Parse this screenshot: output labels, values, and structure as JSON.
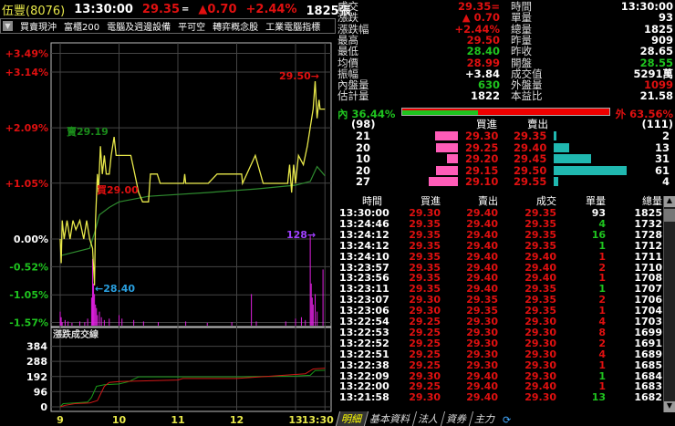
{
  "header": {
    "stock_name": "伍豐(8076)",
    "time": "13:30:00",
    "price": "29.35",
    "flat_mark": "=",
    "change": "▲0.70",
    "change_pct": "+2.44%",
    "volume": "1825張"
  },
  "tags": [
    "買賣現沖",
    "富櫃200",
    "電腦及週邊設備",
    "平可空",
    "轉弈概念股",
    "工業電腦指標"
  ],
  "quote": {
    "left": [
      [
        "成交",
        "29.35=",
        "red"
      ],
      [
        "漲跌",
        "▲ 0.70",
        "red"
      ],
      [
        "漲跌幅",
        "+2.44%",
        "red"
      ],
      [
        "最高",
        "29.50",
        "red"
      ],
      [
        "最低",
        "28.40",
        "green"
      ],
      [
        "均價",
        "28.99",
        "red"
      ],
      [
        "振幅",
        "+3.84",
        "white"
      ],
      [
        "內盤量",
        "630",
        "green"
      ],
      [
        "估計量",
        "1822",
        "white"
      ]
    ],
    "right": [
      [
        "時間",
        "13:30:00",
        "white"
      ],
      [
        "單量",
        "93",
        "white"
      ],
      [
        "總量",
        "1825",
        "white"
      ],
      [
        "昨量",
        "909",
        "white"
      ],
      [
        "昨收",
        "28.65",
        "white"
      ],
      [
        "開盤",
        "28.55",
        "green"
      ],
      [
        "成交值",
        "5291萬",
        "white"
      ],
      [
        "外盤量",
        "1099",
        "red"
      ],
      [
        "本益比",
        "21.58",
        "white"
      ]
    ]
  },
  "ratio": {
    "inner_label": "內 36.44%",
    "outer_label": "外 63.56%",
    "inner_pct": 36.44
  },
  "orderbook": {
    "bid_total": "(98)",
    "ask_total": "(111)",
    "bid_header": "買進",
    "ask_header": "賣出",
    "rows": [
      [
        "21",
        "29.30",
        "29.35",
        "2"
      ],
      [
        "20",
        "29.25",
        "29.40",
        "13"
      ],
      [
        "10",
        "29.20",
        "29.45",
        "31"
      ],
      [
        "20",
        "29.15",
        "29.50",
        "61"
      ],
      [
        "27",
        "29.10",
        "29.55",
        "4"
      ]
    ]
  },
  "ticks": {
    "headers": [
      "時間",
      "買進",
      "賣出",
      "成交",
      "單量",
      "總量"
    ],
    "rows": [
      [
        "13:30:00",
        "29.30",
        "29.40",
        "29.35",
        "93",
        "1825",
        "white"
      ],
      [
        "13:24:46",
        "29.35",
        "29.40",
        "29.35",
        "4",
        "1732",
        "green"
      ],
      [
        "13:24:12",
        "29.35",
        "29.40",
        "29.35",
        "16",
        "1728",
        "green"
      ],
      [
        "13:24:12",
        "29.35",
        "29.40",
        "29.35",
        "1",
        "1712",
        "green"
      ],
      [
        "13:24:10",
        "29.35",
        "29.40",
        "29.40",
        "1",
        "1711",
        "red"
      ],
      [
        "13:23:57",
        "29.35",
        "29.40",
        "29.40",
        "2",
        "1710",
        "red"
      ],
      [
        "13:23:56",
        "29.35",
        "29.40",
        "29.40",
        "1",
        "1708",
        "red"
      ],
      [
        "13:23:11",
        "29.35",
        "29.40",
        "29.35",
        "1",
        "1707",
        "green"
      ],
      [
        "13:23:07",
        "29.30",
        "29.35",
        "29.35",
        "2",
        "1706",
        "red"
      ],
      [
        "13:23:06",
        "29.30",
        "29.35",
        "29.35",
        "1",
        "1704",
        "red"
      ],
      [
        "13:22:54",
        "29.25",
        "29.30",
        "29.30",
        "4",
        "1703",
        "red"
      ],
      [
        "13:22:53",
        "29.25",
        "29.30",
        "29.30",
        "8",
        "1699",
        "red"
      ],
      [
        "13:22:52",
        "29.25",
        "29.30",
        "29.30",
        "2",
        "1691",
        "red"
      ],
      [
        "13:22:51",
        "29.25",
        "29.30",
        "29.30",
        "4",
        "1689",
        "red"
      ],
      [
        "13:22:38",
        "29.25",
        "29.30",
        "29.30",
        "1",
        "1685",
        "red"
      ],
      [
        "13:22:09",
        "29.30",
        "29.40",
        "29.30",
        "1",
        "1684",
        "green"
      ],
      [
        "13:22:00",
        "29.25",
        "29.40",
        "29.40",
        "1",
        "1683",
        "red"
      ],
      [
        "13:21:58",
        "29.30",
        "29.40",
        "29.30",
        "13",
        "1682",
        "green"
      ]
    ]
  },
  "tabs": [
    "明細",
    "基本資料",
    "法人",
    "資券",
    "主力"
  ],
  "chart_data": {
    "type": "line",
    "title": "intraday",
    "prev_close": 28.65,
    "y_ticks": [
      "+3.49%",
      "+3.14%",
      "+2.09%",
      "+1.05%",
      "0.00%",
      "-0.52%",
      "-1.05%",
      "-1.57%"
    ],
    "y_tick_values": [
      3.49,
      3.14,
      2.09,
      1.05,
      0,
      -0.52,
      -1.05,
      -1.57
    ],
    "x_ticks": [
      "9",
      "10",
      "11",
      "12",
      "13",
      "13:30"
    ],
    "x_tick_minutes": [
      0,
      60,
      120,
      180,
      240,
      270
    ],
    "annotations": {
      "high": "29.50→",
      "low": "←28.40",
      "sell": "賣29.19",
      "buy": "買29.00",
      "max_vol": "128→"
    },
    "price": [
      [
        0,
        28.65
      ],
      [
        1,
        28.52
      ],
      [
        2,
        28.75
      ],
      [
        4,
        28.65
      ],
      [
        7,
        28.75
      ],
      [
        10,
        28.65
      ],
      [
        13,
        28.75
      ],
      [
        16,
        28.7
      ],
      [
        20,
        28.75
      ],
      [
        24,
        28.65
      ],
      [
        27,
        28.75
      ],
      [
        30,
        28.65
      ],
      [
        33,
        28.6
      ],
      [
        35,
        28.4
      ],
      [
        36,
        28.75
      ],
      [
        38,
        29.0
      ],
      [
        39,
        28.9
      ],
      [
        41,
        29.15
      ],
      [
        43,
        29.0
      ],
      [
        45,
        29.1
      ],
      [
        47,
        29.0
      ],
      [
        50,
        29.0
      ],
      [
        52,
        29.1
      ],
      [
        55,
        29.2
      ],
      [
        57,
        29.1
      ],
      [
        72,
        29.1
      ],
      [
        74,
        29.05
      ],
      [
        80,
        28.9
      ],
      [
        84,
        28.85
      ],
      [
        90,
        28.85
      ],
      [
        92,
        29.0
      ],
      [
        99,
        29.0
      ],
      [
        102,
        28.95
      ],
      [
        126,
        28.95
      ],
      [
        127,
        29.0
      ],
      [
        128,
        28.95
      ],
      [
        151,
        28.95
      ],
      [
        160,
        29.0
      ],
      [
        185,
        29.0
      ],
      [
        186,
        28.95
      ],
      [
        199,
        29.1
      ],
      [
        207,
        28.95
      ],
      [
        232,
        28.95
      ],
      [
        234,
        29.05
      ],
      [
        236,
        28.9
      ],
      [
        238,
        29.05
      ],
      [
        240,
        28.95
      ],
      [
        243,
        29.1
      ],
      [
        248,
        29.05
      ],
      [
        252,
        29.15
      ],
      [
        255,
        29.25
      ],
      [
        258,
        29.35
      ],
      [
        260,
        29.5
      ],
      [
        262,
        29.3
      ],
      [
        264,
        29.4
      ],
      [
        265,
        29.35
      ],
      [
        270,
        29.35
      ]
    ],
    "avg": [
      [
        0,
        28.56
      ],
      [
        30,
        28.6
      ],
      [
        36,
        28.7
      ],
      [
        40,
        28.78
      ],
      [
        50,
        28.82
      ],
      [
        60,
        28.85
      ],
      [
        90,
        28.88
      ],
      [
        150,
        28.9
      ],
      [
        200,
        28.92
      ],
      [
        240,
        28.94
      ],
      [
        255,
        28.96
      ],
      [
        262,
        29.04
      ],
      [
        270,
        28.99
      ]
    ],
    "volume": [
      [
        0,
        20
      ],
      [
        1,
        12
      ],
      [
        2,
        5
      ],
      [
        5,
        8
      ],
      [
        8,
        6
      ],
      [
        12,
        4
      ],
      [
        20,
        6
      ],
      [
        25,
        5
      ],
      [
        28,
        10
      ],
      [
        32,
        40
      ],
      [
        33,
        95
      ],
      [
        34,
        60
      ],
      [
        35,
        45
      ],
      [
        36,
        30
      ],
      [
        37,
        25
      ],
      [
        38,
        15
      ],
      [
        40,
        20
      ],
      [
        42,
        12
      ],
      [
        45,
        8
      ],
      [
        50,
        10
      ],
      [
        60,
        15
      ],
      [
        63,
        10
      ],
      [
        75,
        8
      ],
      [
        85,
        6
      ],
      [
        100,
        5
      ],
      [
        128,
        6
      ],
      [
        150,
        4
      ],
      [
        175,
        5
      ],
      [
        195,
        45
      ],
      [
        200,
        6
      ],
      [
        230,
        6
      ],
      [
        240,
        10
      ],
      [
        246,
        12
      ],
      [
        250,
        8
      ],
      [
        255,
        128
      ],
      [
        256,
        60
      ],
      [
        257,
        40
      ],
      [
        258,
        30
      ],
      [
        260,
        45
      ],
      [
        262,
        20
      ],
      [
        268,
        80
      ]
    ],
    "lower": {
      "label": "漲跌成交線",
      "y_ticks": [
        "384",
        "288",
        "192",
        "96",
        "0"
      ],
      "y_tick_values": [
        384,
        288,
        192,
        96,
        0
      ],
      "red": [
        [
          0,
          0
        ],
        [
          5,
          10
        ],
        [
          15,
          20
        ],
        [
          30,
          25
        ],
        [
          38,
          40
        ],
        [
          45,
          130
        ],
        [
          50,
          155
        ],
        [
          60,
          160
        ],
        [
          120,
          170
        ],
        [
          125,
          180
        ],
        [
          180,
          180
        ],
        [
          240,
          205
        ],
        [
          250,
          210
        ],
        [
          258,
          240
        ],
        [
          270,
          245
        ]
      ],
      "green": [
        [
          0,
          0
        ],
        [
          3,
          20
        ],
        [
          15,
          25
        ],
        [
          28,
          30
        ],
        [
          32,
          60
        ],
        [
          37,
          130
        ],
        [
          45,
          140
        ],
        [
          60,
          145
        ],
        [
          70,
          160
        ],
        [
          80,
          190
        ],
        [
          120,
          190
        ],
        [
          180,
          190
        ],
        [
          240,
          195
        ],
        [
          255,
          200
        ],
        [
          260,
          230
        ],
        [
          270,
          232
        ]
      ]
    }
  }
}
